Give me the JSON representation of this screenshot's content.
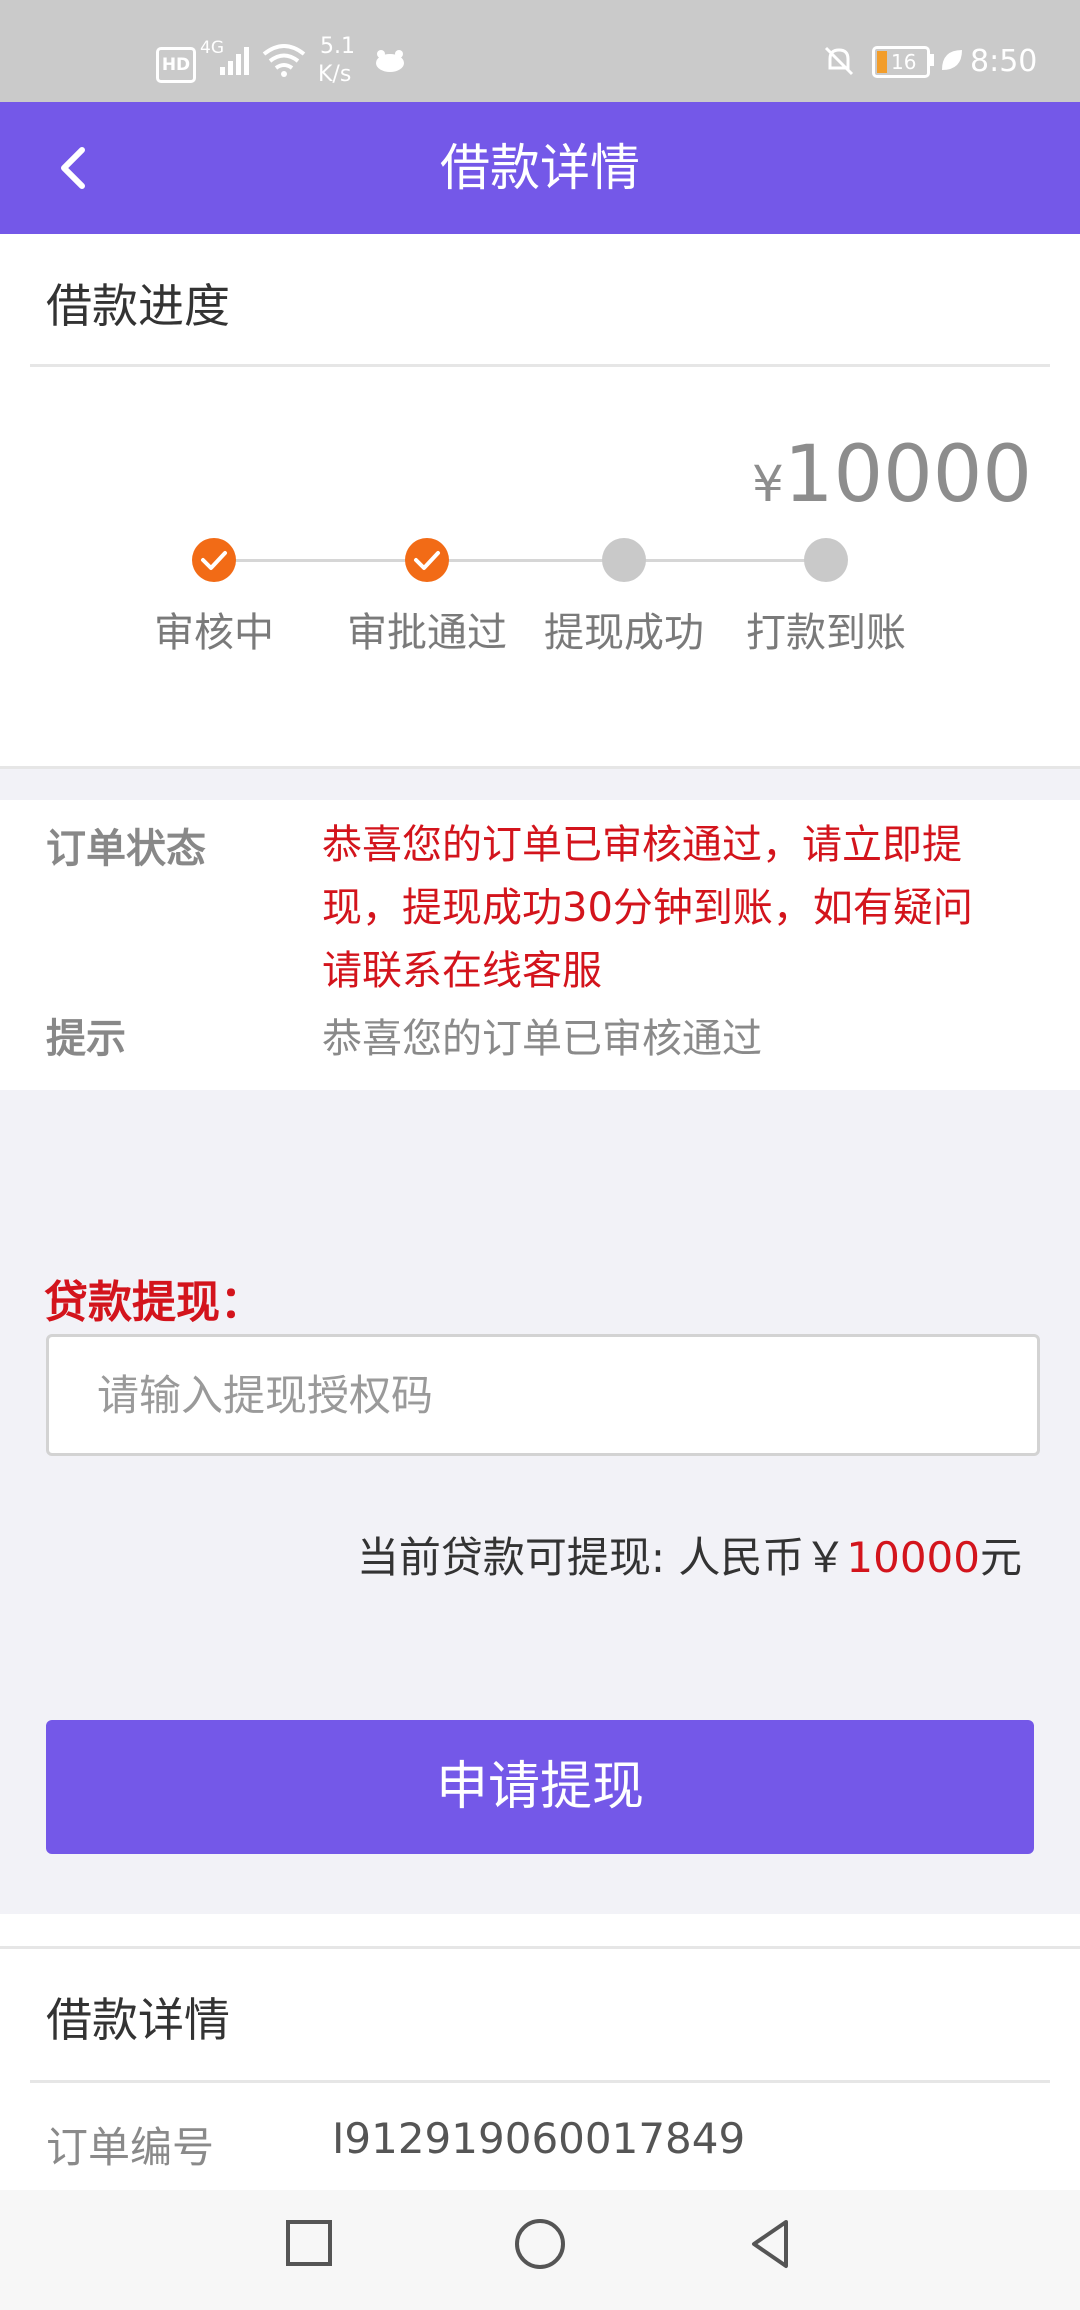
{
  "status_bar": {
    "hd": "HD",
    "network": "4G",
    "speed_value": "5.1",
    "speed_unit": "K/s",
    "battery": "16",
    "time": "8:50"
  },
  "header": {
    "title": "借款详情",
    "back_icon": "chevron-left-icon"
  },
  "progress": {
    "section_title": "借款进度",
    "currency_symbol": "¥",
    "amount": "10000",
    "steps": [
      {
        "label": "审核中",
        "state": "done"
      },
      {
        "label": "审批通过",
        "state": "done"
      },
      {
        "label": "提现成功",
        "state": "pending"
      },
      {
        "label": "打款到账",
        "state": "pending"
      }
    ],
    "colors": {
      "done": "#f26b16",
      "pending": "#c9c9c9"
    }
  },
  "order_status": {
    "label": "订单状态",
    "lines": [
      "恭喜您的订单已审核通过，请立即提",
      "现，提现成功30分钟到账，如有疑问",
      "请联系在线客服"
    ],
    "tip_label": "提示",
    "tip_value": "恭喜您的订单已审核通过"
  },
  "withdraw": {
    "label": "贷款提现：",
    "input_placeholder": "请输入提现授权码",
    "input_value": "",
    "available_prefix": "当前贷款可提现: 人民币￥",
    "available_amount": "10000",
    "available_suffix": "元",
    "button_label": "申请提现"
  },
  "loan_details": {
    "section_title": "借款详情",
    "order_number_label": "订单编号",
    "order_number_value": "I912919060017849"
  },
  "nav_bar": {
    "recent_icon": "square-icon",
    "home_icon": "circle-icon",
    "back_icon": "triangle-back-icon"
  },
  "colors": {
    "accent": "#7458e8",
    "status_bar": "#cacaca",
    "alert_red": "#d3141c",
    "step_done": "#f26b16",
    "step_pending": "#c9c9c9"
  }
}
